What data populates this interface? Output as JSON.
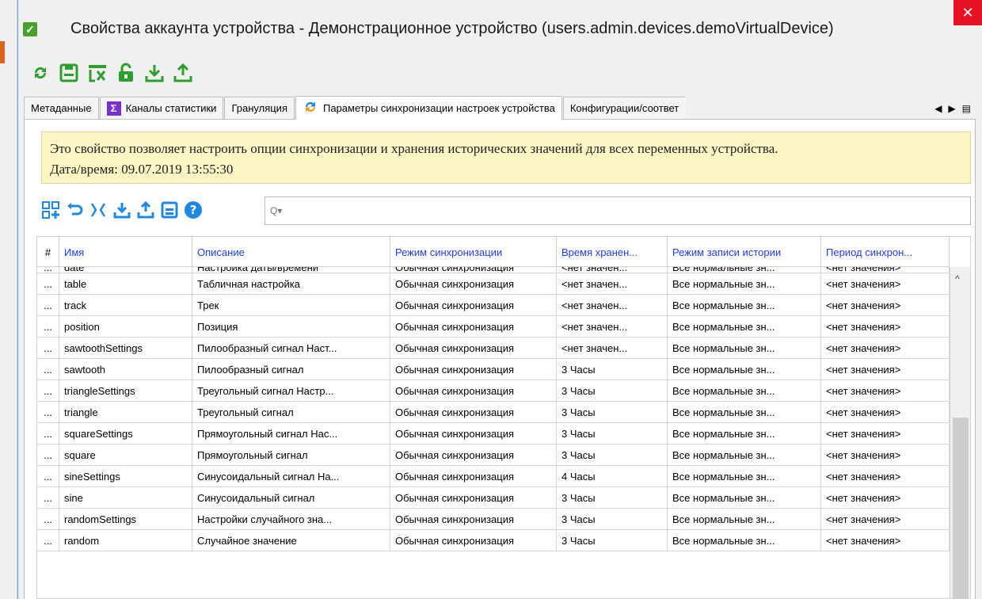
{
  "window": {
    "title": "Свойства аккаунта устройства - Демонстрационное устройство (users.admin.devices.demoVirtualDevice)",
    "close_glyph": "✕"
  },
  "toolbar": {
    "icons": [
      "refresh-icon",
      "save-icon",
      "clear-cache-icon",
      "unlock-icon",
      "import-icon",
      "export-icon"
    ]
  },
  "tabs": [
    {
      "label": "Метаданные",
      "active": false
    },
    {
      "label": "Каналы статистики",
      "active": false
    },
    {
      "label": "Грануляция",
      "active": false
    },
    {
      "label": "Параметры синхронизации настроек устройства",
      "active": true
    },
    {
      "label": "Конфигурации/соответ",
      "active": false
    }
  ],
  "tab_nav": {
    "prev": "◀",
    "next": "▶",
    "menu": "▤"
  },
  "info": {
    "line1": "Это свойство позволяет настроить опции синхронизации и хранения исторических значений для всех переменных устройства.",
    "line2": "Дата/время: 09.07.2019 13:55:30"
  },
  "search": {
    "placeholder": "Q▾"
  },
  "table": {
    "columns": [
      "#",
      "Имя",
      "Описание",
      "Режим синхронизации",
      "Время хранен...",
      "Режим записи истории",
      "Период синхрон..."
    ],
    "partial_row": [
      "...",
      "date",
      "Настройка даты/времени",
      "Обычная синхронизация",
      "<нет значен...",
      "Все нормальные зн...",
      "<нет значения>"
    ],
    "rows": [
      [
        "...",
        "table",
        "Табличная настройка",
        "Обычная синхронизация",
        "<нет значен...",
        "Все нормальные зн...",
        "<нет значения>"
      ],
      [
        "...",
        "track",
        "Трек",
        "Обычная синхронизация",
        "<нет значен...",
        "Все нормальные зн...",
        "<нет значения>"
      ],
      [
        "...",
        "position",
        "Позиция",
        "Обычная синхронизация",
        "<нет значен...",
        "Все нормальные зн...",
        "<нет значения>"
      ],
      [
        "...",
        "sawtoothSettings",
        "Пилообразный сигнал Наст...",
        "Обычная синхронизация",
        "<нет значен...",
        "Все нормальные зн...",
        "<нет значения>"
      ],
      [
        "...",
        "sawtooth",
        "Пилообразный сигнал",
        "Обычная синхронизация",
        "3 Часы",
        "Все нормальные зн...",
        "<нет значения>"
      ],
      [
        "...",
        "triangleSettings",
        "Треугольный сигнал Настр...",
        "Обычная синхронизация",
        "3 Часы",
        "Все нормальные зн...",
        "<нет значения>"
      ],
      [
        "...",
        "triangle",
        "Треугольный сигнал",
        "Обычная синхронизация",
        "3 Часы",
        "Все нормальные зн...",
        "<нет значения>"
      ],
      [
        "...",
        "squareSettings",
        "Прямоугольный сигнал Нас...",
        "Обычная синхронизация",
        "3 Часы",
        "Все нормальные зн...",
        "<нет значения>"
      ],
      [
        "...",
        "square",
        "Прямоугольный сигнал",
        "Обычная синхронизация",
        "3 Часы",
        "Все нормальные зн...",
        "<нет значения>"
      ],
      [
        "...",
        "sineSettings",
        "Синусоидальный сигнал На...",
        "Обычная синхронизация",
        "4 Часы",
        "Все нормальные зн...",
        "<нет значения>"
      ],
      [
        "...",
        "sine",
        "Синусоидальный сигнал",
        "Обычная синхронизация",
        "3 Часы",
        "Все нормальные зн...",
        "<нет значения>"
      ],
      [
        "...",
        "randomSettings",
        "Настройки случайного зна...",
        "Обычная синхронизация",
        "3 Часы",
        "Все нормальные зн...",
        "<нет значения>"
      ],
      [
        "...",
        "random",
        "Случайное значение",
        "Обычная синхронизация",
        "3 Часы",
        "Все нормальные зн...",
        "<нет значения>"
      ]
    ]
  },
  "colors": {
    "accent_green": "#2e9e2e",
    "accent_blue": "#1e88e5",
    "header_text": "#1e3cff",
    "info_bg": "#fbf6c4",
    "close_red": "#e81123"
  }
}
